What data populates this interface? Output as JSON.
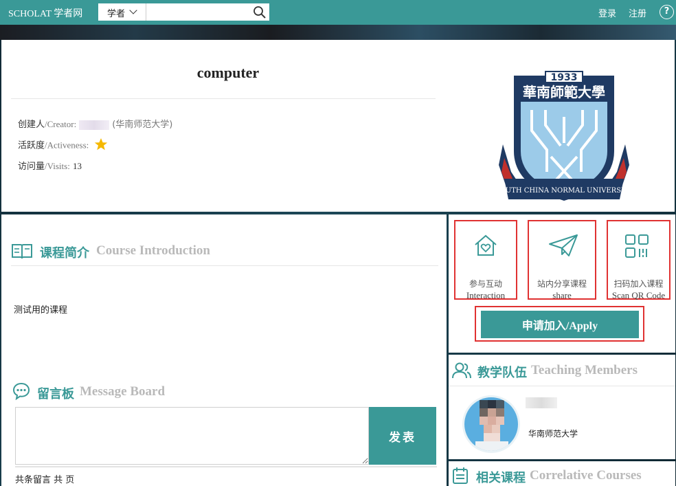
{
  "topbar": {
    "brand": "SCHOLAT 学者网",
    "search_category": "学者",
    "search_placeholder": "",
    "login": "登录",
    "register": "注册",
    "help": "?"
  },
  "course": {
    "title": "computer",
    "creator_label_cn": "创建人",
    "creator_label_en": "/Creator:",
    "creator_org": "(华南师范大学)",
    "activeness_label_cn": "活跃度",
    "activeness_label_en": "/Activeness:",
    "activeness_stars": 1,
    "visits_label_cn": "访问量",
    "visits_label_en": "/Visits:",
    "visits": "13"
  },
  "logo": {
    "year": "1933",
    "name_cn": "華南師範大學",
    "ribbon_text": "SOUTH CHINA NORMAL UNIVERSITY"
  },
  "intro": {
    "title_cn": "课程简介",
    "title_en": "Course Introduction",
    "text": "测试用的课程"
  },
  "message_board": {
    "title_cn": "留言板",
    "title_en": "Message Board",
    "textarea_value": "",
    "submit_label": "发表",
    "stats": "共条留言 共 页"
  },
  "actions": {
    "interaction_cn": "参与互动",
    "interaction_en": "Interaction",
    "share_cn": "站内分享课程",
    "share_en": "share",
    "qr_cn": "扫码加入课程",
    "qr_en": "Scan QR Code",
    "apply": "申请加入/Apply"
  },
  "members": {
    "title_cn": "教学队伍",
    "title_en": "Teaching Members",
    "items": [
      {
        "org": "华南师范大学"
      }
    ]
  },
  "related": {
    "title_cn": "相关课程",
    "title_en": "Correlative Courses"
  },
  "colors": {
    "teal": "#3a9997",
    "highlight_red": "#e03131",
    "muted_heading": "#b9b9b9",
    "star": "#f5b800",
    "logo_navy": "#1f3a63",
    "logo_lightblue": "#9ccbe9",
    "logo_red": "#c0302c"
  }
}
